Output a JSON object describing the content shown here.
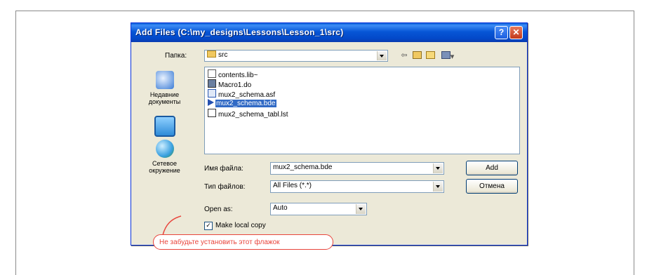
{
  "dialog": {
    "title": "Add Files (C:\\my_designs\\Lessons\\Lesson_1\\src)",
    "help_glyph": "?",
    "close_glyph": "✕"
  },
  "lookin": {
    "label": "Папка:",
    "value": "src"
  },
  "toolbar": {
    "back_glyph": "⇦",
    "views_glyph": "▾"
  },
  "places": [
    {
      "label": "Недавние документы",
      "icon": "recent-documents-icon",
      "color": "#3a7bd5"
    },
    {
      "label": "",
      "icon": "desktop-icon",
      "color": "#2e8bd8"
    },
    {
      "label": "Сетевое окружение",
      "icon": "network-places-icon",
      "color": "#3aa0e0"
    }
  ],
  "files": [
    {
      "name": "contents.lib~",
      "icon": "text-file-icon",
      "selected": false
    },
    {
      "name": "Macro1.do",
      "icon": "macro-file-icon",
      "selected": false
    },
    {
      "name": "mux2_schema.asf",
      "icon": "schema-file-icon",
      "selected": false
    },
    {
      "name": "mux2_schema.bde",
      "icon": "bde-file-icon",
      "selected": true
    },
    {
      "name": "mux2_schema_tabl.lst",
      "icon": "list-file-icon",
      "selected": false
    }
  ],
  "filename": {
    "label": "Имя файла:",
    "value": "mux2_schema.bde"
  },
  "filetype": {
    "label": "Тип файлов:",
    "value": "All Files (*.*)"
  },
  "openas": {
    "label": "Open as:",
    "value": "Auto"
  },
  "buttons": {
    "add": "Add",
    "cancel": "Отмена"
  },
  "make_local_copy": {
    "label": "Make local copy",
    "checked": true,
    "check_glyph": "✓"
  },
  "callout": {
    "text": "Не забудьте установить этот флажок"
  }
}
